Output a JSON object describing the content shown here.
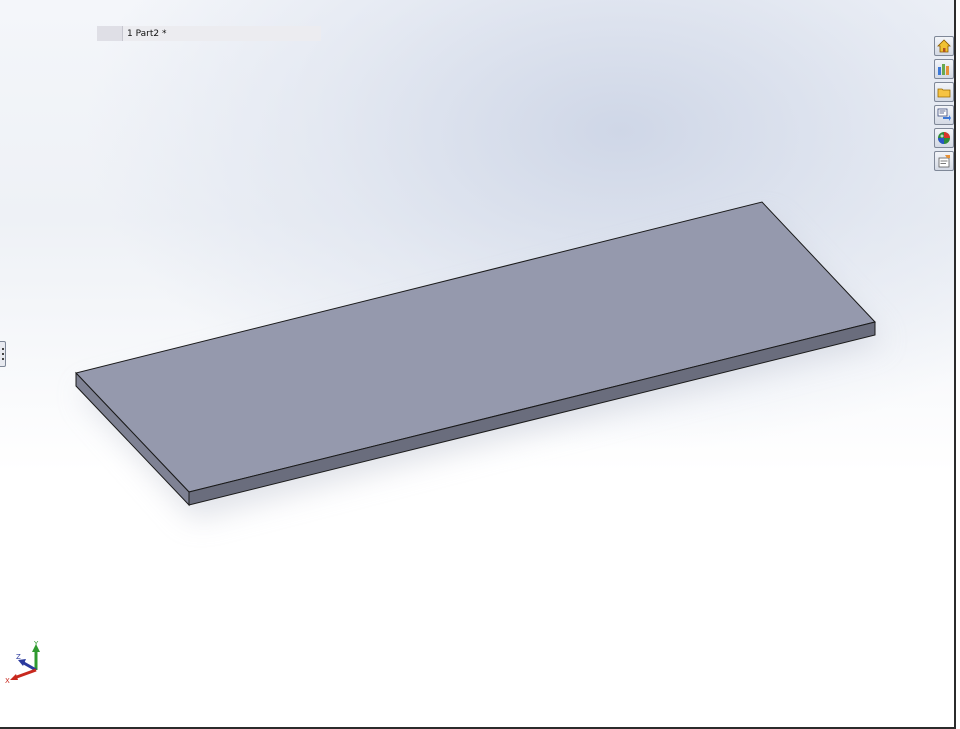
{
  "feature_tree": {
    "row_label": "1 Part2 *"
  },
  "triad": {
    "x_label": "X",
    "y_label": "Y",
    "z_label": "Z"
  },
  "task_pane": {
    "buttons": [
      {
        "icon": "home-icon"
      },
      {
        "icon": "design-library-icon"
      },
      {
        "icon": "folder-icon"
      },
      {
        "icon": "view-palette-icon"
      },
      {
        "icon": "appearances-icon"
      },
      {
        "icon": "custom-properties-icon"
      }
    ]
  },
  "colors": {
    "model_top": "#9599ad",
    "model_side": "#6a6d7d",
    "model_edge": "#1a1a1a",
    "x_axis": "#c8281e",
    "y_axis": "#2f9a2f",
    "z_axis": "#2b3a9e"
  }
}
